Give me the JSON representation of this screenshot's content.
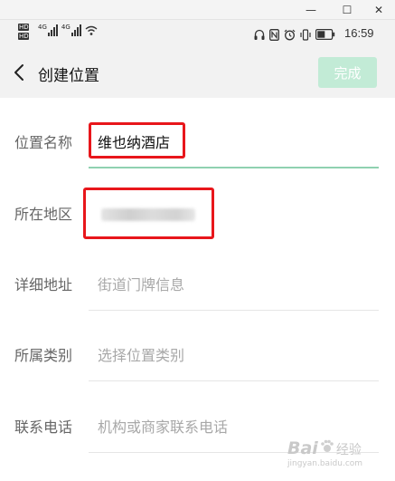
{
  "window": {
    "minimize": "—",
    "maximize": "☐",
    "close": "✕"
  },
  "status_bar": {
    "sim1": "HD",
    "sim2": "HD",
    "net1": "4G",
    "net2": "4G",
    "time": "16:59"
  },
  "header": {
    "title": "创建位置",
    "done_label": "完成"
  },
  "form": {
    "name": {
      "label": "位置名称",
      "value": "维也纳酒店"
    },
    "region": {
      "label": "所在地区"
    },
    "address": {
      "label": "详细地址",
      "placeholder": "街道门牌信息"
    },
    "category": {
      "label": "所属类别",
      "placeholder": "选择位置类别"
    },
    "phone": {
      "label": "联系电话",
      "placeholder": "机构或商家联系电话"
    }
  },
  "watermark": {
    "text": "Bai",
    "suffix": "经验",
    "sub": "jingyan.baidu.com"
  },
  "colors": {
    "done_bg": "#c2ebd6",
    "highlight": "#e8161b",
    "active_line": "#8fd1b0"
  }
}
